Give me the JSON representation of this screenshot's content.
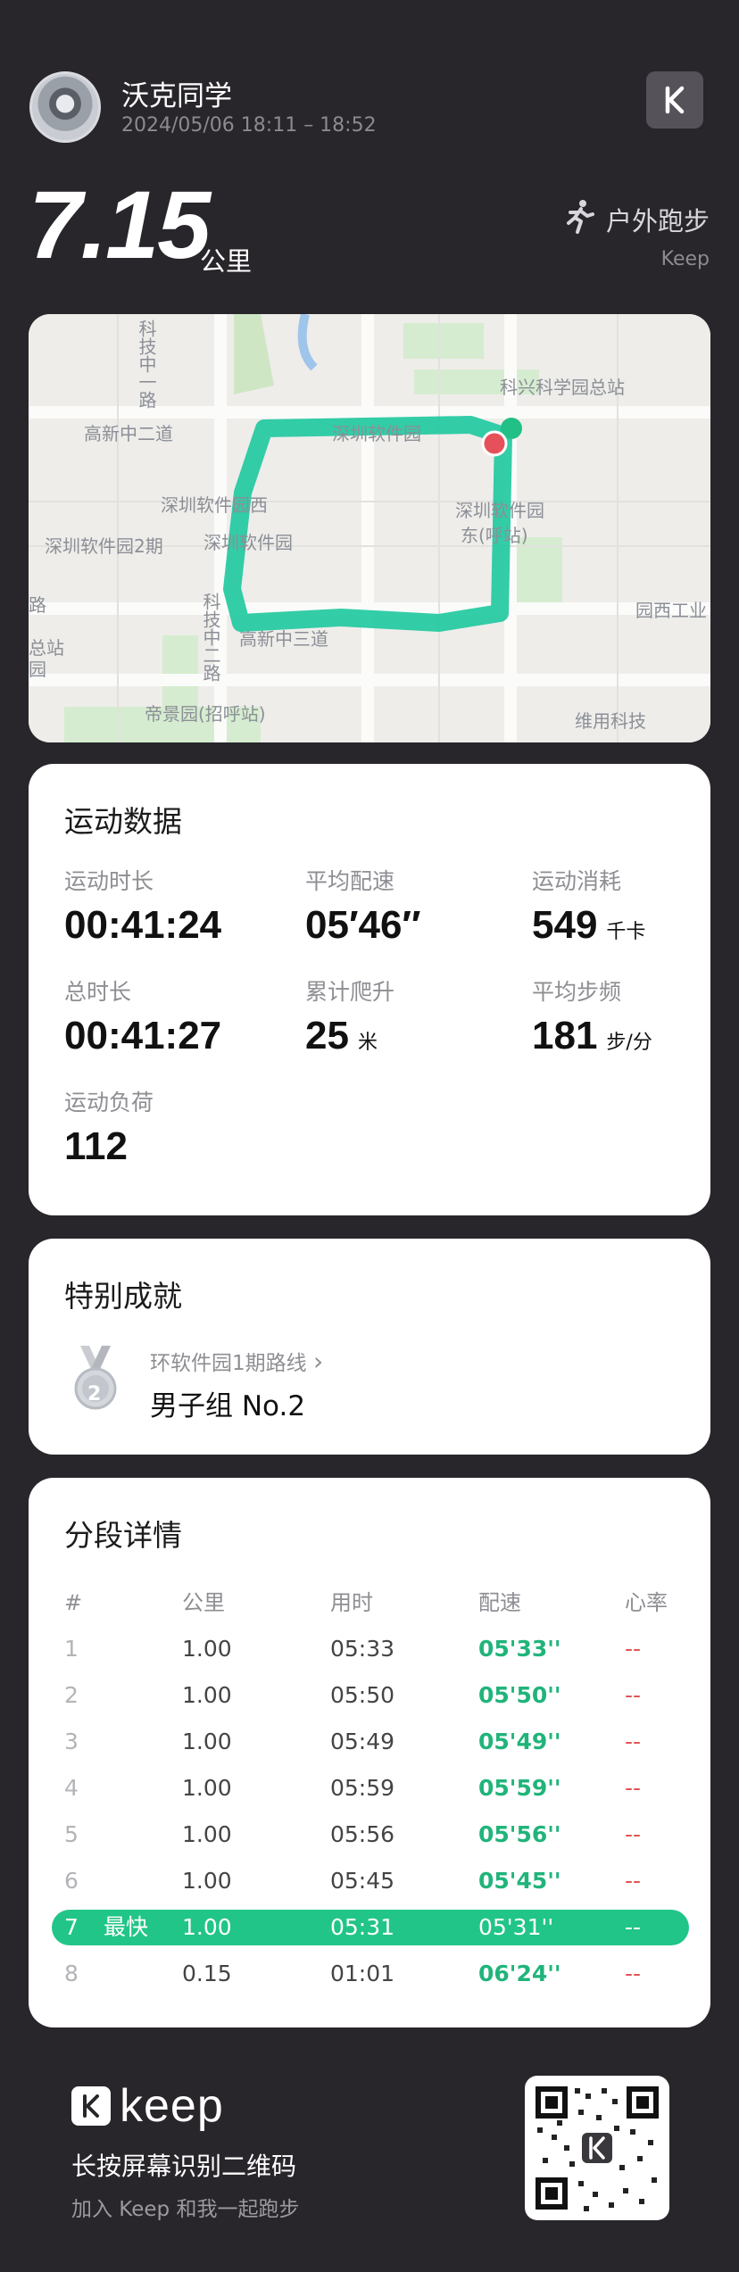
{
  "user": {
    "name": "沃克同学",
    "time_range": "2024/05/06 18:11 – 18:52"
  },
  "summary": {
    "distance": "7.15",
    "distance_unit": "公里",
    "sport_type": "户外跑步",
    "brand": "Keep"
  },
  "map": {
    "labels": [
      "科技中一路",
      "科兴科学园总站",
      "高新中二道",
      "深圳软件园",
      "深圳软件园西",
      "深圳软件园2期",
      "深圳软件园",
      "深圳软件园",
      "东(呼站)",
      "科技中二路",
      "高新中三道",
      "园西工业",
      "总站",
      "帝景园(招呼站)",
      "维用科技",
      "路",
      "园"
    ]
  },
  "exercise": {
    "title": "运动数据",
    "stats": [
      {
        "label": "运动时长",
        "value": "00:41:24",
        "unit": ""
      },
      {
        "label": "平均配速",
        "value": "05′46″",
        "unit": ""
      },
      {
        "label": "运动消耗",
        "value": "549",
        "unit": "千卡"
      },
      {
        "label": "总时长",
        "value": "00:41:27",
        "unit": ""
      },
      {
        "label": "累计爬升",
        "value": "25",
        "unit": "米"
      },
      {
        "label": "平均步频",
        "value": "181",
        "unit": "步/分"
      },
      {
        "label": "运动负荷",
        "value": "112",
        "unit": ""
      }
    ]
  },
  "achievement": {
    "title": "特别成就",
    "route": "环软件园1期路线",
    "chevron": "›",
    "medal_rank": "2",
    "name": "男子组 No.2"
  },
  "splits": {
    "title": "分段详情",
    "headers": [
      "#",
      "公里",
      "用时",
      "配速",
      "心率"
    ],
    "fastest_label": "最快",
    "rows": [
      {
        "n": "1",
        "km": "1.00",
        "time": "05:33",
        "pace": "05'33''",
        "hr": "--"
      },
      {
        "n": "2",
        "km": "1.00",
        "time": "05:50",
        "pace": "05'50''",
        "hr": "--"
      },
      {
        "n": "3",
        "km": "1.00",
        "time": "05:49",
        "pace": "05'49''",
        "hr": "--"
      },
      {
        "n": "4",
        "km": "1.00",
        "time": "05:59",
        "pace": "05'59''",
        "hr": "--"
      },
      {
        "n": "5",
        "km": "1.00",
        "time": "05:56",
        "pace": "05'56''",
        "hr": "--"
      },
      {
        "n": "6",
        "km": "1.00",
        "time": "05:45",
        "pace": "05'45''",
        "hr": "--"
      },
      {
        "n": "7",
        "km": "1.00",
        "time": "05:31",
        "pace": "05'31''",
        "hr": "--"
      },
      {
        "n": "8",
        "km": "0.15",
        "time": "01:01",
        "pace": "06'24''",
        "hr": "--"
      }
    ]
  },
  "footer": {
    "wordmark": "keep",
    "qr_hint": "长按屏幕识别二维码",
    "qr_sub": "加入 Keep 和我一起跑步"
  },
  "colors": {
    "background": "#28262b",
    "accent_green": "#21c587",
    "pace_green": "#21b47a",
    "route": "#22c9a0",
    "hr_red": "#e05555"
  },
  "icons": {
    "sport": "runner-icon",
    "logo": "keep-k-icon",
    "medal": "silver-medal-icon"
  }
}
